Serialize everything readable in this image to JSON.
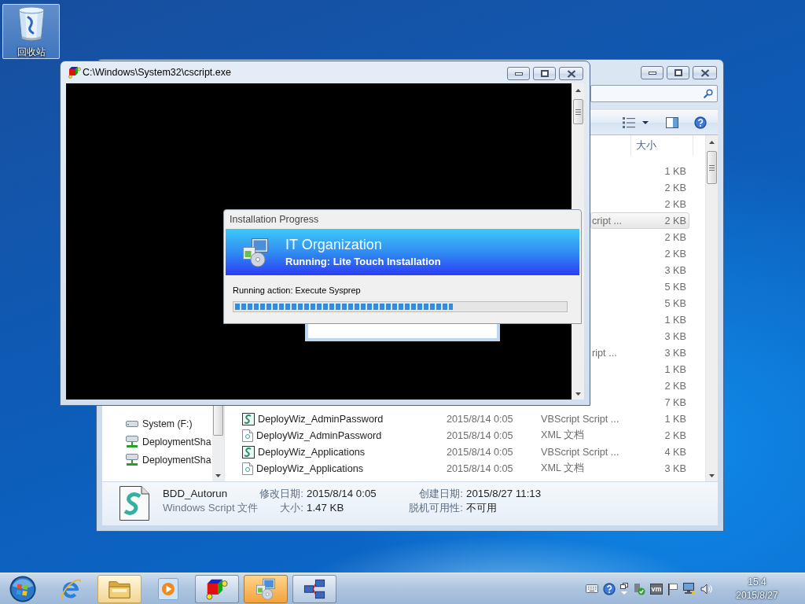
{
  "desktop_icons": [
    {
      "label": "回收站",
      "selected": true
    }
  ],
  "explorer_window": {
    "columns": [
      {
        "label": "大小"
      }
    ],
    "navigation": [
      {
        "kind": "drive",
        "label": "System (F:)"
      },
      {
        "kind": "share",
        "label": "DeploymentSha"
      },
      {
        "kind": "share",
        "label": "DeploymentSha"
      }
    ],
    "files": [
      {
        "size": "1 KB",
        "selected": false
      },
      {
        "size": "2 KB",
        "selected": false
      },
      {
        "size": "2 KB",
        "selected": false
      },
      {
        "type": "cript ...",
        "size": "2 KB",
        "selected": true
      },
      {
        "size": "2 KB",
        "selected": false
      },
      {
        "size": "2 KB",
        "selected": false
      },
      {
        "size": "3 KB",
        "selected": false
      },
      {
        "size": "5 KB",
        "selected": false
      },
      {
        "size": "5 KB",
        "selected": false
      },
      {
        "size": "1 KB",
        "selected": false
      },
      {
        "size": "3 KB",
        "selected": false
      },
      {
        "type": "ript ...",
        "size": "3 KB",
        "selected": false
      },
      {
        "size": "1 KB",
        "selected": false
      },
      {
        "size": "2 KB",
        "selected": false
      },
      {
        "size": "7 KB",
        "selected": false
      },
      {
        "kind": "script",
        "name": "DeployWiz_AdminPassword",
        "date": "2015/8/14 0:05",
        "type": "VBScript Script ...",
        "size": "1 KB",
        "selected": false
      },
      {
        "kind": "xml",
        "name": "DeployWiz_AdminPassword",
        "date": "2015/8/14 0:05",
        "type": "XML 文档",
        "size": "2 KB",
        "selected": false
      },
      {
        "kind": "script",
        "name": "DeployWiz_Applications",
        "date": "2015/8/14 0:05",
        "type": "VBScript Script ...",
        "size": "4 KB",
        "selected": false
      },
      {
        "kind": "xml",
        "name": "DeployWiz_Applications",
        "date": "2015/8/14 0:05",
        "type": "XML 文档",
        "size": "3 KB",
        "selected": false
      }
    ],
    "details": {
      "name": "BDD_Autorun",
      "type": "Windows Script 文件",
      "fields": [
        {
          "label": "修改日期:",
          "value": "2015/8/14 0:05"
        },
        {
          "label": "创建日期:",
          "value": "2015/8/27 11:13"
        },
        {
          "label": "大小:",
          "value": "1.47 KB"
        },
        {
          "label": "脱机可用性:",
          "value": "不可用"
        }
      ]
    }
  },
  "cscript_window": {
    "title": "C:\\Windows\\System32\\cscript.exe"
  },
  "progress_dialog": {
    "title": "Installation Progress",
    "heading": "IT Organization",
    "subheading": "Running: Lite Touch Installation",
    "action": "Running action: Execute Sysprep",
    "level": 0.66
  },
  "taskbar": {
    "apps": [
      {
        "kind": "browser",
        "running": false,
        "highlighted": false,
        "selected": false
      },
      {
        "kind": "folder",
        "running": true,
        "highlighted": true,
        "selected": false
      },
      {
        "kind": "media",
        "running": false,
        "highlighted": false,
        "selected": false
      },
      {
        "kind": "cube",
        "running": true,
        "highlighted": false,
        "selected": false
      },
      {
        "kind": "installer",
        "running": true,
        "highlighted": false,
        "selected": true
      },
      {
        "kind": "network",
        "running": true,
        "highlighted": false,
        "selected": false
      }
    ],
    "tray_tile": "vm",
    "clock": {
      "time": "15:4",
      "date": "2015/8/27"
    }
  }
}
